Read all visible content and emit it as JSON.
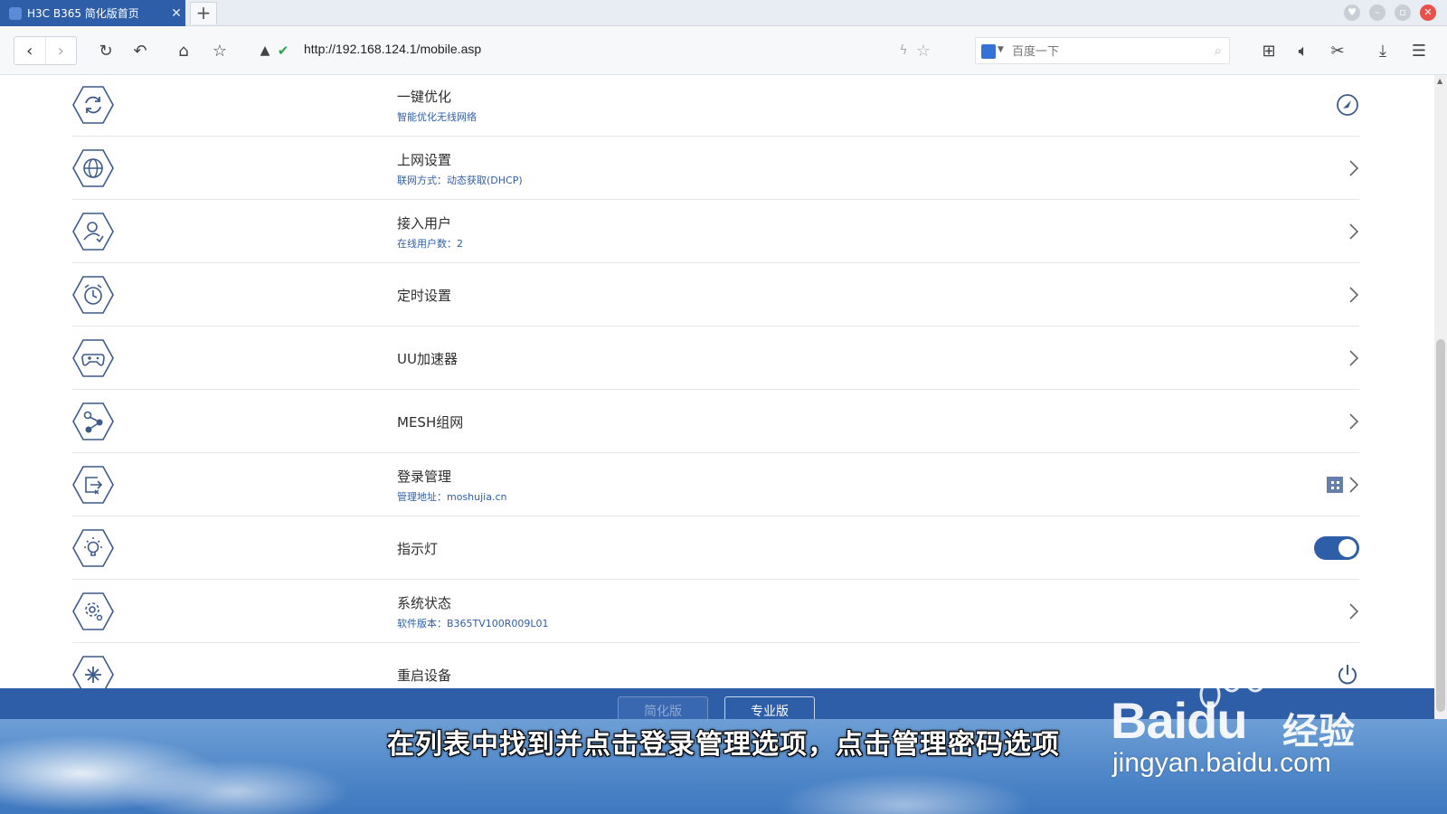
{
  "browser": {
    "tab_title": "H3C B365 简化版首页",
    "tab_close": "✕",
    "new_tab": "+",
    "url": "http://192.168.124.1/mobile.asp",
    "search_placeholder": "百度一下"
  },
  "rows": [
    {
      "icon": "refresh-icon",
      "title": "一键优化",
      "subtitle": "智能优化无线网络",
      "action": "compass-icon"
    },
    {
      "icon": "globe-icon",
      "title": "上网设置",
      "subtitle": "联网方式：动态获取(DHCP)",
      "action": "chevron-right-icon"
    },
    {
      "icon": "user-icon",
      "title": "接入用户",
      "subtitle": "在线用户数：2",
      "action": "chevron-right-icon"
    },
    {
      "icon": "alarm-clock-icon",
      "title": "定时设置",
      "subtitle": "",
      "action": "chevron-right-icon"
    },
    {
      "icon": "gamepad-icon",
      "title": "UU加速器",
      "subtitle": "",
      "action": "chevron-right-icon"
    },
    {
      "icon": "mesh-network-icon",
      "title": "MESH组网",
      "subtitle": "",
      "action": "chevron-right-icon"
    },
    {
      "icon": "login-icon",
      "title": "登录管理",
      "subtitle": "管理地址：moshujia.cn",
      "action": "chevron-right-icon"
    },
    {
      "icon": "light-bulb-icon",
      "title": "指示灯",
      "subtitle": "",
      "action": "toggle"
    },
    {
      "icon": "gear-icon",
      "title": "系统状态",
      "subtitle": "软件版本：B365TV100R009L01",
      "action": "chevron-right-icon"
    },
    {
      "icon": "restart-icon",
      "title": "重启设备",
      "subtitle": "",
      "action": "power-icon"
    }
  ],
  "indicator_light_on": true,
  "footer": {
    "simple_label": "简化版",
    "pro_label": "专业版"
  },
  "caption": "在列表中找到并点击登录管理选项，点击管理密码选项",
  "watermark": {
    "logo": "Baidu",
    "jingyan": "经验",
    "url": "jingyan.baidu.com"
  },
  "colors": {
    "brand_blue": "#2f5ea8",
    "icon_stroke": "#3d5a8a",
    "subtitle": "#2f5ea8"
  }
}
